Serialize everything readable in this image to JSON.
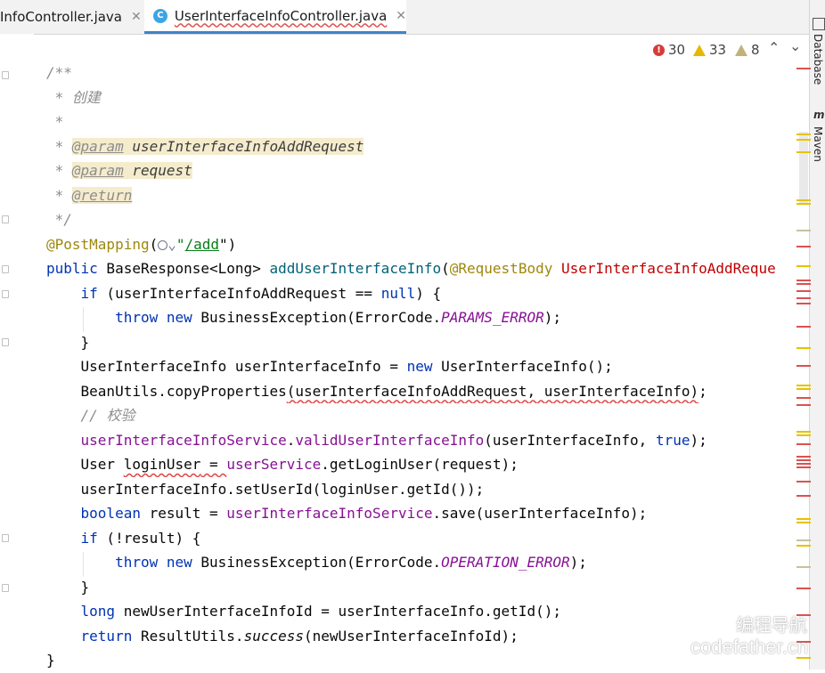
{
  "tabs": [
    {
      "label": "InfoController.java",
      "close": "✕"
    },
    {
      "label": "UserInterfaceInfoController.java",
      "close": "✕",
      "icon_letter": "C",
      "active": true
    }
  ],
  "inspection": {
    "errors": "30",
    "warnings": "33",
    "weak_warnings": "8"
  },
  "tool_windows": [
    {
      "label": "Database"
    },
    {
      "label": "Maven"
    }
  ],
  "code": {
    "l1": "/**",
    "l2_star": " * ",
    "l2_text": "创建",
    "l3": " *",
    "l4_star": " * ",
    "l4_tag": "@param",
    "l4_val": "userInterfaceInfoAddRequest",
    "l5_star": " * ",
    "l5_tag": "@param",
    "l5_val": "request",
    "l6_star": " * ",
    "l6_tag": "@return",
    "l7": " */",
    "l8_ann": "@PostMapping",
    "l8_open": "(",
    "l8_chev": "⌄",
    "l8_q": "\"",
    "l8_str": "/add",
    "l8_close": "\")",
    "l9_kw": "public",
    "l9_type": " BaseResponse<Long> ",
    "l9_fn": "addUserInterfaceInfo",
    "l9_paren": "(",
    "l9_ann": "@RequestBody",
    "l9_param": " UserInterfaceInfoAddReque",
    "l10_if": "if",
    "l10_a": " (userInterfaceInfoAddRequest == ",
    "l10_null": "null",
    "l10_b": ") {",
    "l11_throw": "throw",
    "l11_new": "new",
    "l11_a": " BusinessException(ErrorCode.",
    "l11_const": "PARAMS_ERROR",
    "l11_b": ");",
    "l12": "}",
    "l13_a": "UserInterfaceInfo userInterfaceInfo = ",
    "l13_new": "new",
    "l13_b": " UserInterfaceInfo();",
    "l14_a": "BeanUtils.copyProperties",
    "l14_b": "(userInterfaceInfoAddRequest, userInterfaceInfo)",
    "l14_c": ";",
    "l15_cm": "// ",
    "l15_text": "校验",
    "l16_field": "userInterfaceInfoService",
    "l16_dot": ".",
    "l16_fn": "validUserInterfaceInfo",
    "l16_a": "(userInterfaceInfo, ",
    "l16_true": "true",
    "l16_b": ");",
    "l17_a": "User ",
    "l17_var": "loginUser",
    "l17_eq": " = ",
    "l17_field": "userService",
    "l17_b": ".getLoginUser(request);",
    "l18": "userInterfaceInfo.setUserId(loginUser.getId());",
    "l19_kw": "boolean",
    "l19_a": " result = ",
    "l19_field": "userInterfaceInfoService",
    "l19_b": ".save(userInterfaceInfo);",
    "l20_if": "if",
    "l20_a": " (!result) {",
    "l21_throw": "throw",
    "l21_new": "new",
    "l21_a": " BusinessException(ErrorCode.",
    "l21_const": "OPERATION_ERROR",
    "l21_b": ");",
    "l22": "}",
    "l23_kw": "long",
    "l23_a": " newUserInterfaceInfoId = userInterfaceInfo.getId();",
    "l24_kw": "return",
    "l24_a": " ResultUtils.",
    "l24_fn": "success",
    "l24_b": "(newUserInterfaceInfoId);",
    "l25": "}"
  },
  "watermark": {
    "cn": "编程导航",
    "en": "codefather.cn"
  },
  "colors": {
    "keyword": "#0033b3",
    "field": "#871094",
    "annotation": "#9e880d",
    "error_marker": "#d9534f",
    "warning_marker": "#e6c200"
  }
}
